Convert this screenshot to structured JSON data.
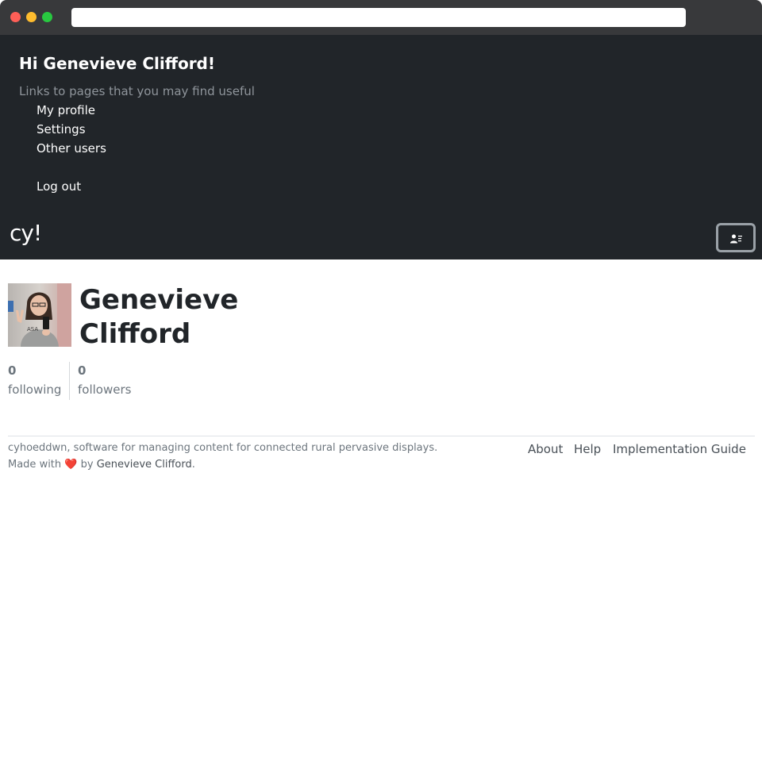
{
  "browser": {
    "url": ""
  },
  "nav": {
    "greeting": "Hi Genevieve Clifford!",
    "subtitle": "Links to pages that you may find useful",
    "links": {
      "my_profile": "My profile",
      "settings": "Settings",
      "other_users": "Other users",
      "log_out": "Log out"
    },
    "brand": "cy!",
    "toggler_icon": "user-list-icon"
  },
  "profile": {
    "name": "Genevieve Clifford",
    "avatar_icon": "user-photo",
    "following_count": "0",
    "following_label": "following",
    "followers_count": "0",
    "followers_label": "followers"
  },
  "footer": {
    "description": "cyhoeddwn, software for managing content for connected rural pervasive displays.",
    "made_prefix": "Made with",
    "heart": "❤️",
    "made_by": "by",
    "author": "Genevieve Clifford",
    "made_suffix": ".",
    "links": {
      "about": "About",
      "help": "Help",
      "implementation_guide": "Implementation Guide"
    }
  },
  "colors": {
    "nav_background": "#212529",
    "chrome": "#38393b",
    "muted_text": "#6c757d",
    "heart": "#d0202e"
  }
}
